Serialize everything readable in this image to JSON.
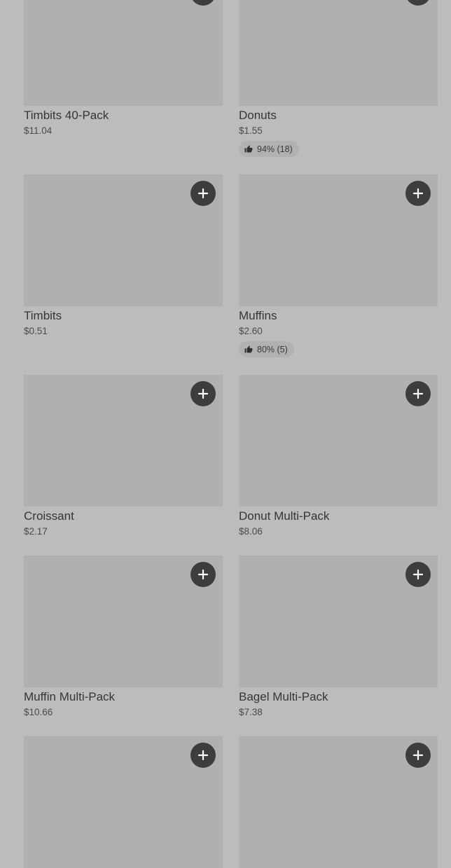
{
  "icons": {
    "add": "plus-icon",
    "rating": "thumbs-up-icon"
  },
  "colors": {
    "page_background": "#bcbcbc",
    "thumbnail_placeholder": "#b0b0b0",
    "add_button": "#3d3d3d",
    "rating_badge": "#b1b1b1"
  },
  "products": [
    {
      "name": "Timbits 40-Pack",
      "price": "$11.04"
    },
    {
      "name": "Donuts",
      "price": "$1.55",
      "rating": "94% (18)"
    },
    {
      "name": "Timbits",
      "price": "$0.51"
    },
    {
      "name": "Muffins",
      "price": "$2.60",
      "rating": "80% (5)"
    },
    {
      "name": "Croissant",
      "price": "$2.17"
    },
    {
      "name": "Donut Multi-Pack",
      "price": "$8.06"
    },
    {
      "name": "Muffin Multi-Pack",
      "price": "$10.66"
    },
    {
      "name": "Bagel Multi-Pack",
      "price": "$7.38"
    },
    {
      "name": "",
      "price": ""
    },
    {
      "name": "",
      "price": ""
    }
  ]
}
